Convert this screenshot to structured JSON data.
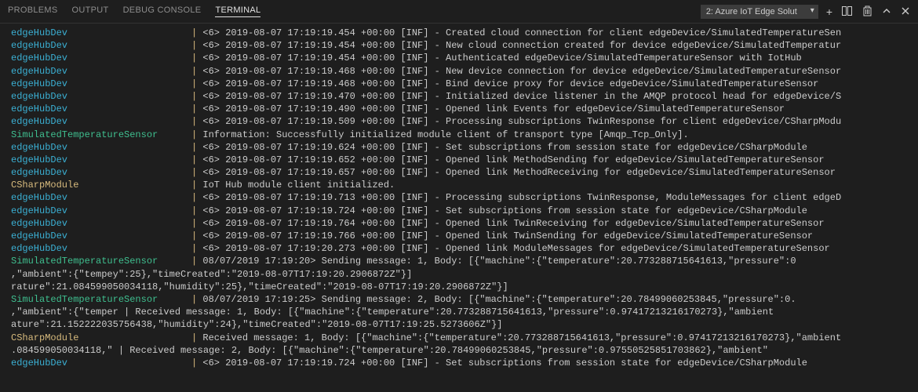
{
  "tabs": {
    "problems": "PROBLEMS",
    "output": "OUTPUT",
    "debug": "DEBUG CONSOLE",
    "terminal": "TERMINAL"
  },
  "dropdown": {
    "selected": "2: Azure IoT Edge Solut"
  },
  "lines": [
    {
      "src": "edgeHubDev",
      "cls": "src-edge",
      "msg": "<6> 2019-08-07 17:19:19.454 +00:00 [INF] - Created cloud connection for client edgeDevice/SimulatedTemperatureSen"
    },
    {
      "src": "edgeHubDev",
      "cls": "src-edge",
      "msg": "<6> 2019-08-07 17:19:19.454 +00:00 [INF] - New cloud connection created for device edgeDevice/SimulatedTemperatur"
    },
    {
      "src": "edgeHubDev",
      "cls": "src-edge",
      "msg": "<6> 2019-08-07 17:19:19.454 +00:00 [INF] - Authenticated edgeDevice/SimulatedTemperatureSensor with IotHub"
    },
    {
      "src": "edgeHubDev",
      "cls": "src-edge",
      "msg": "<6> 2019-08-07 17:19:19.468 +00:00 [INF] - New device connection for device edgeDevice/SimulatedTemperatureSensor"
    },
    {
      "src": "edgeHubDev",
      "cls": "src-edge",
      "msg": "<6> 2019-08-07 17:19:19.468 +00:00 [INF] - Bind device proxy for device edgeDevice/SimulatedTemperatureSensor"
    },
    {
      "src": "edgeHubDev",
      "cls": "src-edge",
      "msg": "<6> 2019-08-07 17:19:19.470 +00:00 [INF] - Initialized device listener in the AMQP protocol head for edgeDevice/S"
    },
    {
      "src": "edgeHubDev",
      "cls": "src-edge",
      "msg": "<6> 2019-08-07 17:19:19.490 +00:00 [INF] - Opened link Events for edgeDevice/SimulatedTemperatureSensor"
    },
    {
      "src": "edgeHubDev",
      "cls": "src-edge",
      "msg": "<6> 2019-08-07 17:19:19.509 +00:00 [INF] - Processing subscriptions TwinResponse for client edgeDevice/CSharpModu"
    },
    {
      "src": "SimulatedTemperatureSensor",
      "cls": "src-sim",
      "msg": "Information: Successfully initialized module client of transport type [Amqp_Tcp_Only]."
    },
    {
      "src": "edgeHubDev",
      "cls": "src-edge",
      "msg": "<6> 2019-08-07 17:19:19.624 +00:00 [INF] - Set subscriptions from session state for edgeDevice/CSharpModule"
    },
    {
      "src": "edgeHubDev",
      "cls": "src-edge",
      "msg": "<6> 2019-08-07 17:19:19.652 +00:00 [INF] - Opened link MethodSending for edgeDevice/SimulatedTemperatureSensor"
    },
    {
      "src": "edgeHubDev",
      "cls": "src-edge",
      "msg": "<6> 2019-08-07 17:19:19.657 +00:00 [INF] - Opened link MethodReceiving for edgeDevice/SimulatedTemperatureSensor"
    },
    {
      "src": "CSharpModule",
      "cls": "src-csharp",
      "msg": "IoT Hub module client initialized."
    },
    {
      "src": "edgeHubDev",
      "cls": "src-edge",
      "msg": "<6> 2019-08-07 17:19:19.713 +00:00 [INF] - Processing subscriptions TwinResponse, ModuleMessages for client edgeD"
    },
    {
      "src": "edgeHubDev",
      "cls": "src-edge",
      "msg": "<6> 2019-08-07 17:19:19.724 +00:00 [INF] - Set subscriptions from session state for edgeDevice/CSharpModule"
    },
    {
      "src": "edgeHubDev",
      "cls": "src-edge",
      "msg": "<6> 2019-08-07 17:19:19.764 +00:00 [INF] - Opened link TwinReceiving for edgeDevice/SimulatedTemperatureSensor"
    },
    {
      "src": "edgeHubDev",
      "cls": "src-edge",
      "msg": "<6> 2019-08-07 17:19:19.766 +00:00 [INF] - Opened link TwinSending for edgeDevice/SimulatedTemperatureSensor"
    },
    {
      "src": "edgeHubDev",
      "cls": "src-edge",
      "msg": "<6> 2019-08-07 17:19:20.273 +00:00 [INF] - Opened link ModuleMessages for edgeDevice/SimulatedTemperatureSensor"
    },
    {
      "src": "SimulatedTemperatureSensor",
      "cls": "src-sim",
      "msg": "        08/07/2019 17:19:20> Sending message: 1, Body: [{\"machine\":{\"temperature\":20.773288715641613,\"pressure\":0"
    },
    {
      "wrap": ",\"ambient\":{\"tempey\":25},\"timeCreated\":\"2019-08-07T17:19:20.2906872Z\"}]"
    },
    {
      "wrap": "rature\":21.084599050034118,\"humidity\":25},\"timeCreated\":\"2019-08-07T17:19:20.2906872Z\"}]"
    },
    {
      "src": "SimulatedTemperatureSensor",
      "cls": "src-sim",
      "msg": "        08/07/2019 17:19:25> Sending message: 2, Body: [{\"machine\":{\"temperature\":20.78499060253845,\"pressure\":0."
    },
    {
      "wrap": ",\"ambient\":{\"temper          | Received message: 1, Body: [{\"machine\":{\"temperature\":20.773288715641613,\"pressure\":0.97417213216170273},\"ambient"
    },
    {
      "wrap": "ature\":21.152222035756438,\"humidity\":24},\"timeCreated\":\"2019-08-07T17:19:25.5273606Z\"}]"
    },
    {
      "src": "CSharpModule",
      "cls": "src-csharp",
      "msg": "Received message: 1, Body: [{\"machine\":{\"temperature\":20.773288715641613,\"pressure\":0.97417213216170273},\"ambient"
    },
    {
      "wrap": ".084599050034118,\"           | Received message: 2, Body: [{\"machine\":{\"temperature\":20.78499060253845,\"pressure\":0.97550525851703862},\"ambient\""
    },
    {
      "src": "edgeHubDev",
      "cls": "src-edge",
      "msg": "<6> 2019-08-07 17:19:19.724 +00:00 [INF] - Set subscriptions from session state for edgeDevice/CSharpModule"
    }
  ]
}
